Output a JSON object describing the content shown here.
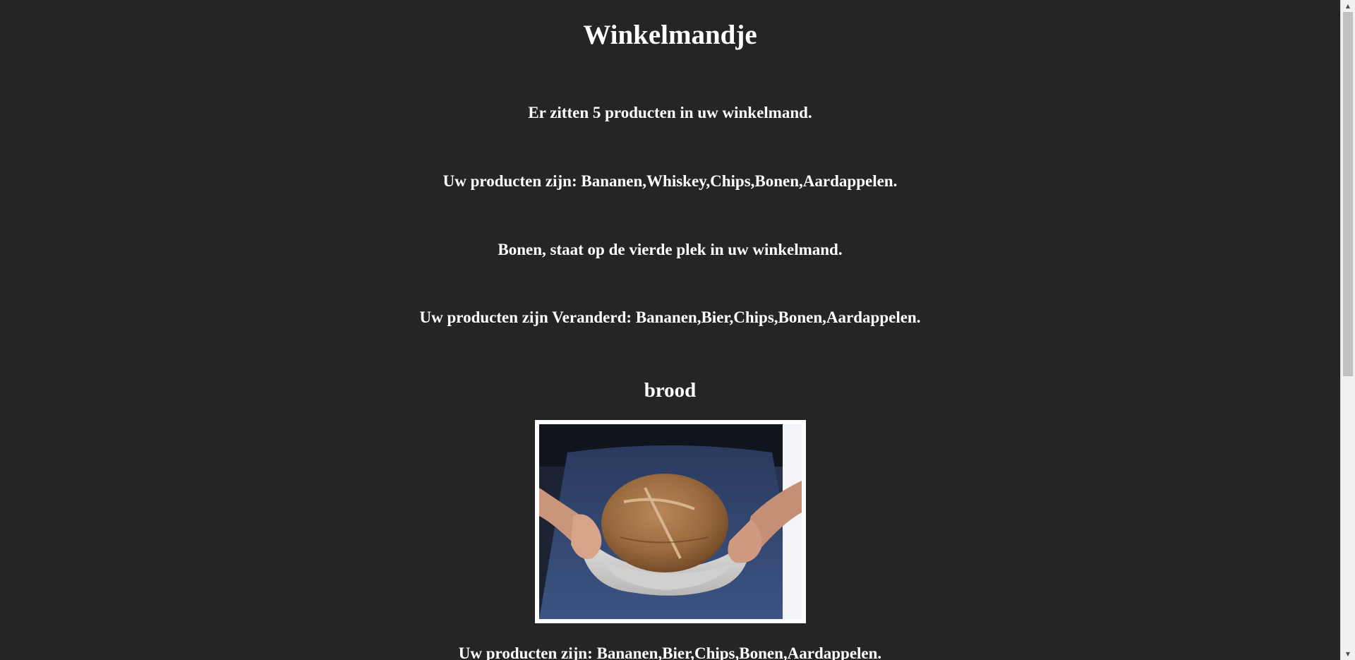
{
  "page": {
    "title": "Winkelmandje",
    "count_text": "Er zitten 5 producten in uw winkelmand.",
    "products_text": "Uw producten zijn: Bananen,Whiskey,Chips,Bonen,Aardappelen.",
    "position_text": "Bonen, staat op de vierde plek in uw winkelmand.",
    "changed_text": "Uw producten zijn Veranderd: Bananen,Bier,Chips,Bonen,Aardappelen.",
    "product_heading": "brood",
    "final_text": "Uw producten zijn: Bananen,Bier,Chips,Bonen,Aardappelen."
  },
  "colors": {
    "background": "#252525",
    "text": "#ffffff",
    "image_frame": "#ffffff"
  },
  "scrollbar": {
    "up_icon": "triangle-up-icon",
    "down_icon": "triangle-down-icon"
  }
}
